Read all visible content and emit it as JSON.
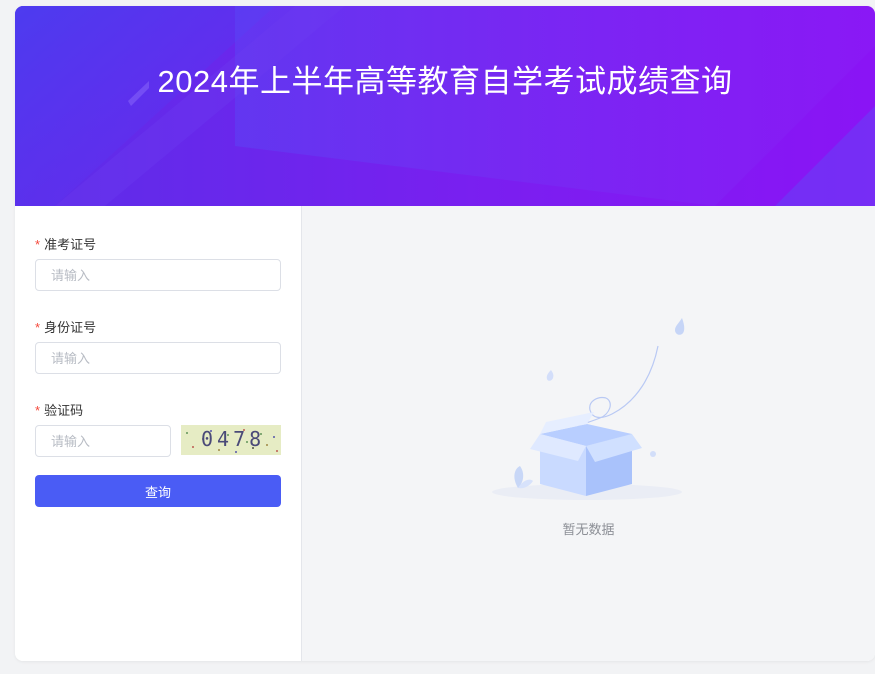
{
  "header": {
    "title": "2024年上半年高等教育自学考试成绩查询"
  },
  "form": {
    "required_mark": "*",
    "exam_id": {
      "label": "准考证号",
      "placeholder": "请输入",
      "value": ""
    },
    "id_card": {
      "label": "身份证号",
      "placeholder": "请输入",
      "value": ""
    },
    "captcha": {
      "label": "验证码",
      "placeholder": "请输入",
      "value": "",
      "image_text": "0478"
    },
    "submit_label": "查询"
  },
  "result": {
    "empty_text": "暂无数据",
    "icon": "empty-box-icon"
  },
  "colors": {
    "banner_start": "#5b2ee8",
    "banner_end": "#8a14f5",
    "primary": "#4a5cf5",
    "required": "#f5483b"
  }
}
